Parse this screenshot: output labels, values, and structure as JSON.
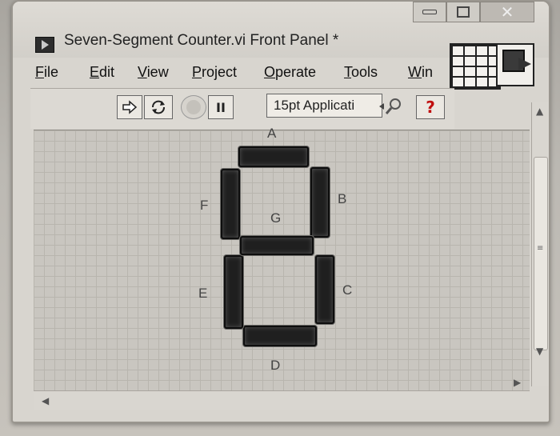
{
  "window": {
    "title": "Seven-Segment Counter.vi Front Panel *"
  },
  "menu": {
    "items": [
      {
        "accel": "F",
        "rest": "ile"
      },
      {
        "accel": "E",
        "rest": "dit"
      },
      {
        "accel": "V",
        "rest": "iew"
      },
      {
        "accel": "P",
        "rest": "roject"
      },
      {
        "accel": "O",
        "rest": "perate"
      },
      {
        "accel": "T",
        "rest": "ools"
      },
      {
        "accel": "W",
        "rest": "in"
      }
    ]
  },
  "toolbar": {
    "run_icon": "run-arrow-icon",
    "run_continuous_icon": "run-continuously-icon",
    "abort_icon": "abort-execution-icon",
    "pause_label": "II",
    "font_setting": "15pt Applicati",
    "search_icon": "search-icon",
    "help_label": "?"
  },
  "display": {
    "segments": [
      {
        "id": "A",
        "label": "A"
      },
      {
        "id": "B",
        "label": "B"
      },
      {
        "id": "C",
        "label": "C"
      },
      {
        "id": "D",
        "label": "D"
      },
      {
        "id": "E",
        "label": "E"
      },
      {
        "id": "F",
        "label": "F"
      },
      {
        "id": "G",
        "label": "G"
      }
    ]
  }
}
